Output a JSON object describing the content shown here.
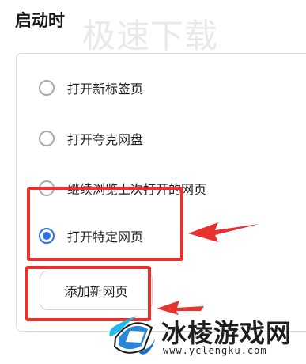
{
  "header": {
    "title": "启动时",
    "watermark_text": "极速下载"
  },
  "startup_options": [
    {
      "label": "打开新标签页",
      "selected": false
    },
    {
      "label": "打开夸克网盘",
      "selected": false
    },
    {
      "label": "继续浏览上次打开的网页",
      "selected": false
    },
    {
      "label": "打开特定网页",
      "selected": true
    }
  ],
  "add_page_button": {
    "label": "添加新网页"
  },
  "annotation": {
    "highlight_color": "#e8322f"
  },
  "colors": {
    "accent": "#2f6fe9"
  },
  "brand": {
    "name": "冰棱游戏网",
    "url": "www.yclengku.com"
  }
}
